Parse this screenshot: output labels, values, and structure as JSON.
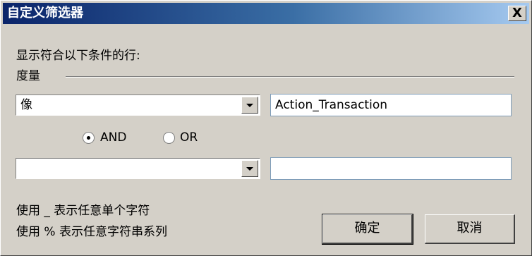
{
  "dialog": {
    "title": "自定义筛选器",
    "close_label": "X"
  },
  "instructions": "显示符合以下条件的行:",
  "group_label": "度量",
  "condition1": {
    "operator": "像",
    "value": "Action_Transaction"
  },
  "logic": {
    "and_label": "AND",
    "or_label": "OR",
    "selected": "AND"
  },
  "condition2": {
    "operator": "",
    "value": ""
  },
  "hints": {
    "single_char": "使用 _ 表示任意单个字符",
    "multi_char": "使用 % 表示任意字符串系列"
  },
  "buttons": {
    "ok": "确定",
    "cancel": "取消"
  }
}
